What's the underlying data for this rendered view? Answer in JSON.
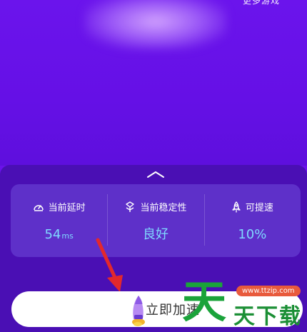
{
  "header": {
    "more_games_label": "更多游戏"
  },
  "stats": [
    {
      "label": "当前延时",
      "value": "54",
      "unit": "ms",
      "icon": "speedometer-icon"
    },
    {
      "label": "当前稳定性",
      "value": "良好",
      "unit": "",
      "icon": "stability-icon"
    },
    {
      "label": "可提速",
      "value": "10%",
      "unit": "",
      "icon": "rocket-icon"
    }
  ],
  "action": {
    "accelerate_label": "立即加速"
  },
  "watermark": {
    "site": "www.ttzip.com",
    "big_char": "天",
    "text": "天下载"
  },
  "colors": {
    "background": "#6b12ea",
    "panel": "#4a0fb4",
    "card": "#5e30c9",
    "value_text": "#7fd9ff",
    "arrow": "#e3282c"
  }
}
